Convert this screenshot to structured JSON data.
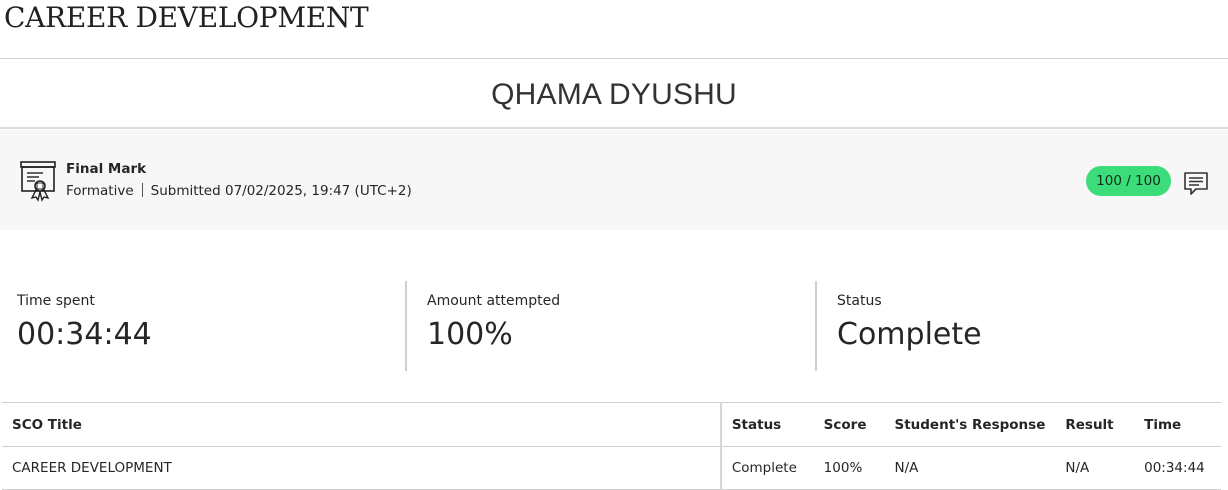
{
  "header": {
    "course_title": "CAREER DEVELOPMENT",
    "student_name": "QHAMA DYUSHU"
  },
  "grade": {
    "icon": "certificate-icon",
    "title": "Final Mark",
    "category": "Formative",
    "submitted": "Submitted 07/02/2025, 19:47 (UTC+2)",
    "score": "100 / 100",
    "score_color": "#3ddc7a",
    "feedback_icon": "comment-icon"
  },
  "stats": [
    {
      "label": "Time spent",
      "value": "00:34:44"
    },
    {
      "label": "Amount attempted",
      "value": "100%"
    },
    {
      "label": "Status",
      "value": "Complete"
    }
  ],
  "table": {
    "columns": [
      "SCO Title",
      "Status",
      "Score",
      "Student's Response",
      "Result",
      "Time"
    ],
    "rows": [
      [
        "CAREER DEVELOPMENT",
        "Complete",
        "100%",
        "N/A",
        "N/A",
        "00:34:44"
      ]
    ]
  }
}
